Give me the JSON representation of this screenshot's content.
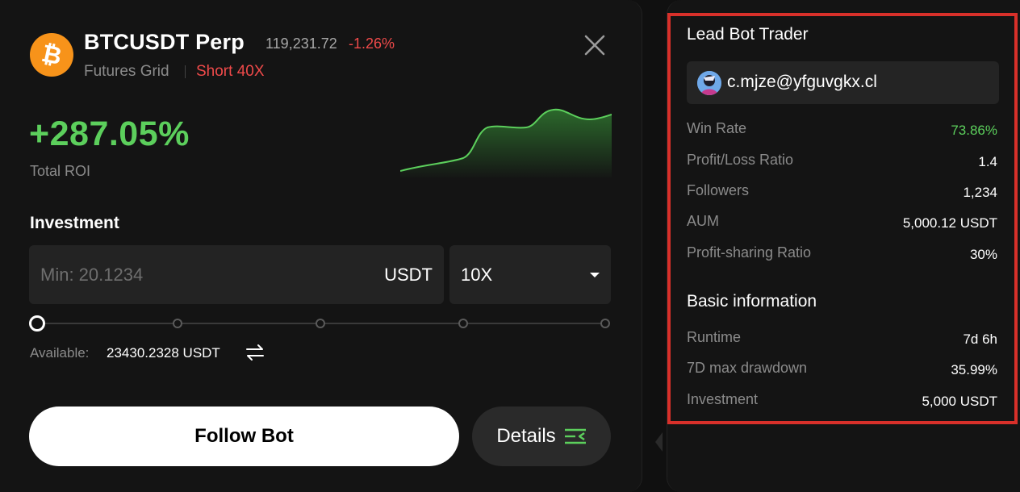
{
  "header": {
    "pair": "BTCUSDT Perp",
    "price": "119,231.72",
    "change": "-1.26%",
    "bot_type": "Futures Grid",
    "position": "Short 40X",
    "coin_icon": "bitcoin-icon",
    "close_icon": "close-icon"
  },
  "roi": {
    "value": "+287.05%",
    "label": "Total ROI"
  },
  "investment": {
    "title": "Investment",
    "placeholder": "Min: 20.1234",
    "unit": "USDT",
    "leverage": "10X",
    "slider_value": 0,
    "available_label": "Available:",
    "available_value": "23430.2328 USDT"
  },
  "actions": {
    "follow": "Follow Bot",
    "details": "Details"
  },
  "lead_trader": {
    "title": "Lead Bot Trader",
    "name": "c.mjze@yfguvgkx.cl",
    "stats": [
      {
        "label": "Win Rate",
        "value": "73.86%"
      },
      {
        "label": "Profit/Loss Ratio",
        "value": "1.4"
      },
      {
        "label": "Followers",
        "value": "1,234"
      },
      {
        "label": "AUM",
        "value": "5,000.12 USDT"
      },
      {
        "label": "Profit-sharing Ratio",
        "value": "30%"
      }
    ]
  },
  "basic_info": {
    "title": "Basic information",
    "items": [
      {
        "label": "Runtime",
        "value": "7d 6h"
      },
      {
        "label": "7D max drawdown",
        "value": "35.99%"
      },
      {
        "label": "Investment",
        "value": "5,000 USDT"
      }
    ]
  },
  "colors": {
    "positive": "#5ccf5c",
    "negative": "#ef4a4a",
    "highlight_border": "#d8302a",
    "bitcoin": "#f7931a"
  }
}
